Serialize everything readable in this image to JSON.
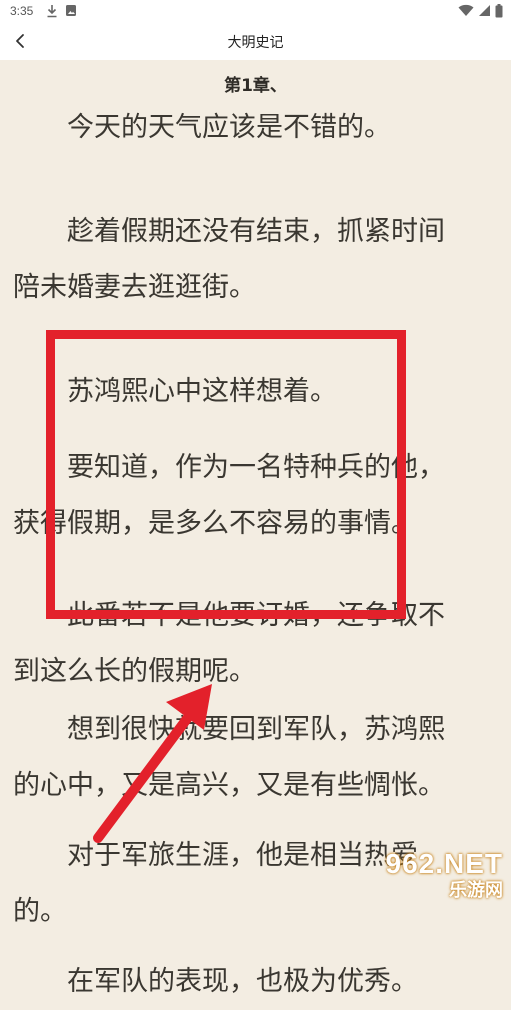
{
  "status_bar": {
    "time": "3:35",
    "icons": [
      "download-icon",
      "image-notification-icon",
      "wifi-icon",
      "cellular-signal-icon",
      "battery-icon"
    ]
  },
  "app_bar": {
    "title": "大明史记",
    "back_icon": "chevron-left-icon"
  },
  "chapter": {
    "title": "第1章、"
  },
  "paragraphs": [
    "今天的天气应该是不错的。",
    "趁着假期还没有结束，抓紧时间陪未婚妻去逛逛街。",
    "苏鸿熙心中这样想着。",
    "要知道，作为一名特种兵的他，获得假期，是多么不容易的事情。",
    "此番若不是他要订婚，还争取不到这么长的假期呢。",
    "想到很快就要回到军队，苏鸿熙的心中，又是高兴，又是有些惆怅。",
    "对于军旅生涯，他是相当热爱的。",
    "在军队的表现，也极为优秀。"
  ],
  "annotation": {
    "box_color": "#e3212b",
    "arrow_color": "#e3212b"
  },
  "watermark": {
    "main": "962.NET",
    "sub": "乐游网"
  }
}
